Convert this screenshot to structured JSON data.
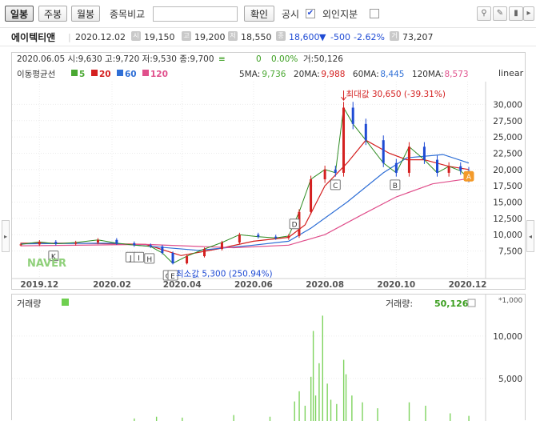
{
  "toolbar": {
    "period_day": "일봉",
    "period_week": "주봉",
    "period_month": "월봉",
    "compare_label": "종목비교",
    "compare_placeholder": "",
    "confirm": "확인",
    "disclosure_label": "공시",
    "disclosure_checked": true,
    "foreign_label": "외인지분",
    "foreign_checked": false,
    "tool_icons": [
      "pin-icon",
      "pencil-icon",
      "eraser-icon",
      "play-icon",
      "settings-icon"
    ]
  },
  "quote": {
    "name": "에이텍티앤",
    "date": "2020.12.02",
    "open_icon": "시",
    "open": "19,150",
    "high_icon": "고",
    "high": "19,200",
    "low_icon": "저",
    "low": "18,550",
    "close_icon": "종",
    "close": "18,600",
    "change_arrow": "▼",
    "change": "-500",
    "change_pct": "-2.62%",
    "volume_icon": "거",
    "volume": "73,207"
  },
  "legend": {
    "ohlc_line": "2020.06.05 시:9,630 고:9,720 저:9,530 종:9,700",
    "ohlc_mark": "≡",
    "chg": "0",
    "chg_pct": "0.00%",
    "vol": "거:50,126",
    "ma_title": "이동평균선",
    "ma_items": [
      {
        "label": "5",
        "color": "#4aa832"
      },
      {
        "label": "20",
        "color": "#d42020"
      },
      {
        "label": "60",
        "color": "#2f6fd6"
      },
      {
        "label": "120",
        "color": "#e0508c"
      }
    ],
    "ma_values": [
      {
        "label": "5MA:",
        "value": "9,736",
        "color": "#4aa832"
      },
      {
        "label": "20MA:",
        "value": "9,988",
        "color": "#d42020"
      },
      {
        "label": "60MA:",
        "value": "8,445",
        "color": "#2f6fd6"
      },
      {
        "label": "120MA:",
        "value": "8,573",
        "color": "#e0508c"
      }
    ],
    "scale": "linear",
    "watermark": "NAVER"
  },
  "annotations": {
    "max_label": "최대값 30,650 (-39.31%)",
    "min_label": "최소값 5,300 (250.94%)",
    "markers": [
      {
        "t": "K",
        "date": "2019-12-13"
      },
      {
        "t": "J",
        "date": "2020-02-17"
      },
      {
        "t": "I",
        "date": "2020-02-24"
      },
      {
        "t": "H",
        "date": "2020-03-04"
      },
      {
        "t": "G",
        "date": "2020-03-20"
      },
      {
        "t": "E",
        "date": "2020-03-24"
      },
      {
        "t": "D",
        "date": "2020-07-06"
      },
      {
        "t": "C",
        "date": "2020-08-10"
      },
      {
        "t": "B",
        "date": "2020-09-30"
      },
      {
        "t": "A",
        "date": "2020-12-02"
      }
    ]
  },
  "chart_data": [
    {
      "type": "candlestick",
      "title": "",
      "y_scale": "linear",
      "ylim": [
        4500,
        33000
      ],
      "y_ticks": [
        7500,
        10000,
        12500,
        15000,
        17500,
        20000,
        22500,
        25000,
        27500,
        30000
      ],
      "y_tick_labels": [
        "7,500",
        "10,000",
        "12,500",
        "15,000",
        "17,500",
        "20,000",
        "22,500",
        "25,000",
        "27,500",
        "30,000"
      ],
      "x_ticks": [
        "2019-12",
        "2020-02",
        "2020-04",
        "2020-06",
        "2020-08",
        "2020-10",
        "2020-12"
      ],
      "x_tick_labels": [
        "2019.12",
        "2020.02",
        "2020.04",
        "2020.06",
        "2020.08",
        "2020.10",
        "2020.12"
      ],
      "x_range": [
        "2019-11-13",
        "2020-12-15"
      ],
      "close_series": [
        [
          "2019-11-15",
          8500
        ],
        [
          "2019-12-01",
          8900
        ],
        [
          "2019-12-15",
          8600
        ],
        [
          "2020-01-01",
          8800
        ],
        [
          "2020-01-20",
          9200
        ],
        [
          "2020-02-05",
          8700
        ],
        [
          "2020-02-20",
          8400
        ],
        [
          "2020-03-05",
          8200
        ],
        [
          "2020-03-15",
          7200
        ],
        [
          "2020-03-24",
          5600
        ],
        [
          "2020-04-05",
          6700
        ],
        [
          "2020-04-20",
          7800
        ],
        [
          "2020-05-05",
          8800
        ],
        [
          "2020-05-20",
          10000
        ],
        [
          "2020-06-05",
          9700
        ],
        [
          "2020-06-20",
          9500
        ],
        [
          "2020-07-01",
          9800
        ],
        [
          "2020-07-10",
          13500
        ],
        [
          "2020-07-20",
          18500
        ],
        [
          "2020-08-01",
          20000
        ],
        [
          "2020-08-10",
          19500
        ],
        [
          "2020-08-17",
          29500
        ],
        [
          "2020-08-25",
          27000
        ],
        [
          "2020-09-05",
          24500
        ],
        [
          "2020-09-20",
          21000
        ],
        [
          "2020-10-01",
          19500
        ],
        [
          "2020-10-12",
          23500
        ],
        [
          "2020-10-25",
          21500
        ],
        [
          "2020-11-05",
          19500
        ],
        [
          "2020-11-15",
          20500
        ],
        [
          "2020-11-25",
          19800
        ],
        [
          "2020-12-02",
          18600
        ]
      ],
      "ma_series": [
        {
          "name": "20",
          "color": "#d42020",
          "points": [
            [
              "2019-11-15",
              8700
            ],
            [
              "2020-01-01",
              8700
            ],
            [
              "2020-03-01",
              8500
            ],
            [
              "2020-03-31",
              6800
            ],
            [
              "2020-05-01",
              7800
            ],
            [
              "2020-06-01",
              9000
            ],
            [
              "2020-07-01",
              9600
            ],
            [
              "2020-07-15",
              11500
            ],
            [
              "2020-08-01",
              17500
            ],
            [
              "2020-08-20",
              21000
            ],
            [
              "2020-09-05",
              24500
            ],
            [
              "2020-09-25",
              22500
            ],
            [
              "2020-10-10",
              21500
            ],
            [
              "2020-10-25",
              21500
            ],
            [
              "2020-11-15",
              20500
            ],
            [
              "2020-12-02",
              20000
            ]
          ]
        },
        {
          "name": "60",
          "color": "#2f6fd6",
          "points": [
            [
              "2019-11-15",
              8600
            ],
            [
              "2020-02-01",
              8700
            ],
            [
              "2020-04-15",
              7600
            ],
            [
              "2020-06-01",
              8400
            ],
            [
              "2020-07-01",
              9000
            ],
            [
              "2020-07-20",
              11000
            ],
            [
              "2020-08-20",
              15000
            ],
            [
              "2020-09-20",
              19500
            ],
            [
              "2020-10-10",
              21800
            ],
            [
              "2020-11-10",
              22300
            ],
            [
              "2020-12-02",
              21000
            ]
          ]
        },
        {
          "name": "120",
          "color": "#e0508c",
          "points": [
            [
              "2019-11-15",
              8300
            ],
            [
              "2020-03-01",
              8500
            ],
            [
              "2020-05-15",
              8000
            ],
            [
              "2020-07-01",
              8400
            ],
            [
              "2020-08-01",
              10000
            ],
            [
              "2020-09-01",
              13000
            ],
            [
              "2020-10-01",
              15800
            ],
            [
              "2020-11-01",
              17800
            ],
            [
              "2020-12-02",
              18600
            ]
          ]
        }
      ],
      "max_point": {
        "date": "2020-08-17",
        "value": 30650
      },
      "min_point": {
        "date": "2020-03-24",
        "value": 5300
      }
    },
    {
      "type": "bar",
      "title": "거래량",
      "legend_label": "거래량:",
      "legend_value": "50,126",
      "unit_label": "*1,000",
      "ylim": [
        0,
        13000
      ],
      "y_ticks": [
        5000,
        10000
      ],
      "y_tick_labels": [
        "5,000",
        "10,000"
      ],
      "volume_series": [
        [
          "2020-02-20",
          300
        ],
        [
          "2020-03-10",
          500
        ],
        [
          "2020-04-01",
          400
        ],
        [
          "2020-05-15",
          700
        ],
        [
          "2020-06-15",
          500
        ],
        [
          "2020-07-06",
          2300
        ],
        [
          "2020-07-10",
          3500
        ],
        [
          "2020-07-15",
          1800
        ],
        [
          "2020-07-20",
          5200
        ],
        [
          "2020-07-22",
          10600
        ],
        [
          "2020-07-24",
          3000
        ],
        [
          "2020-07-27",
          6800
        ],
        [
          "2020-07-30",
          12400
        ],
        [
          "2020-08-03",
          4400
        ],
        [
          "2020-08-06",
          2500
        ],
        [
          "2020-08-11",
          2000
        ],
        [
          "2020-08-17",
          7200
        ],
        [
          "2020-08-19",
          5500
        ],
        [
          "2020-08-24",
          3000
        ],
        [
          "2020-09-02",
          2200
        ],
        [
          "2020-09-15",
          1500
        ],
        [
          "2020-10-12",
          2200
        ],
        [
          "2020-10-26",
          1800
        ],
        [
          "2020-11-16",
          900
        ],
        [
          "2020-12-02",
          600
        ]
      ]
    }
  ]
}
